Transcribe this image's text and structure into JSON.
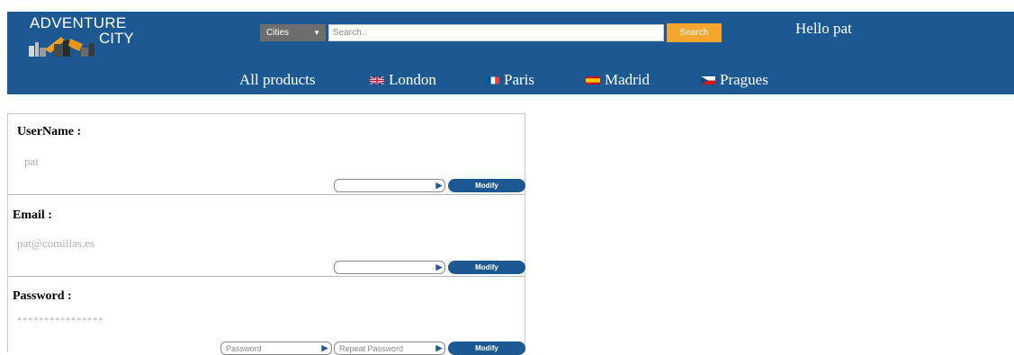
{
  "header": {
    "logo": {
      "title": "ADVENTURE",
      "subtitle": "CITY"
    },
    "search": {
      "category_selected": "Cities",
      "placeholder": "Search..",
      "button_label": "Search"
    },
    "greeting": "Hello pat",
    "nav": [
      {
        "label": "All products",
        "flag": ""
      },
      {
        "label": "London",
        "flag": "uk-flag"
      },
      {
        "label": "Paris",
        "flag": "france-flag"
      },
      {
        "label": "Madrid",
        "flag": "spain-flag"
      },
      {
        "label": "Pragues",
        "flag": "czech-flag"
      }
    ]
  },
  "profile": {
    "username": {
      "label": "UserName :",
      "value": "pat",
      "button_label": "Modify"
    },
    "email": {
      "label": "Email :",
      "value": "pat@comillas.es",
      "button_label": "Modify"
    },
    "password": {
      "label": "Password :",
      "value": "****************",
      "password_placeholder": "Password",
      "repeat_placeholder": "Repeat Password",
      "button_label": "Modify"
    }
  },
  "colors": {
    "header_bg": "#1c5993",
    "search_button": "#f4a52d",
    "select_bg": "#6d6d6d"
  }
}
